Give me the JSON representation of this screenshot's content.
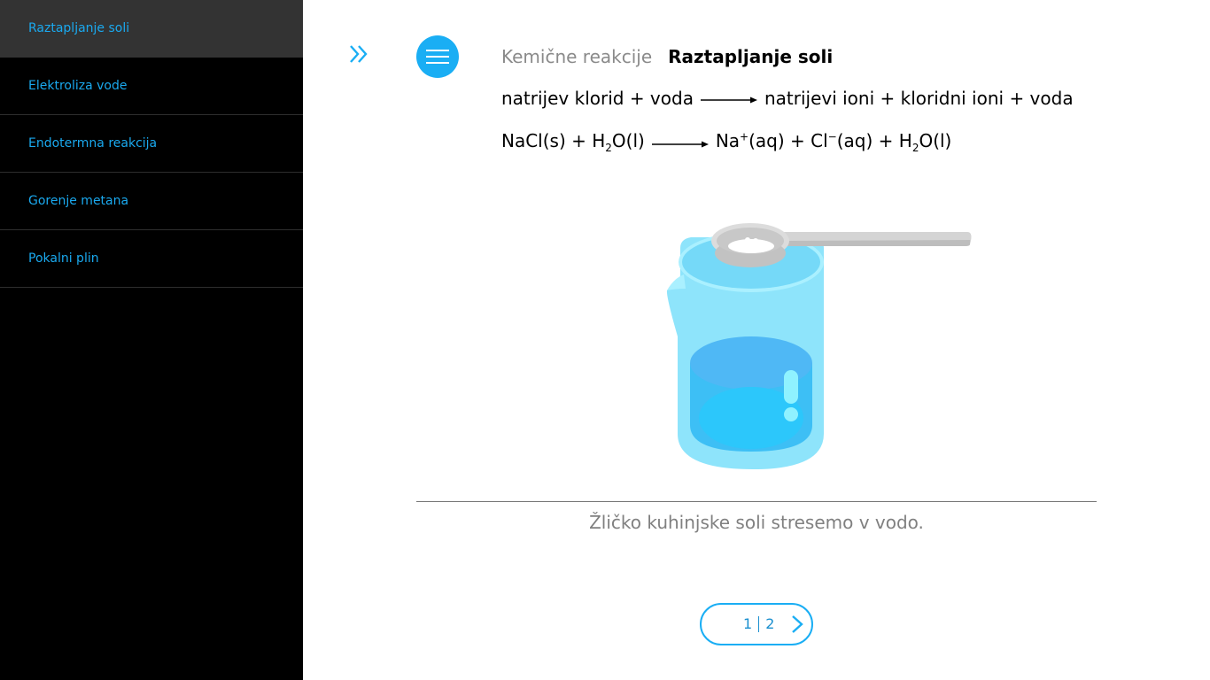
{
  "sidebar": {
    "items": [
      {
        "label": "Raztapljanje soli",
        "active": true
      },
      {
        "label": "Elektroliza vode",
        "active": false
      },
      {
        "label": "Endotermna reakcija",
        "active": false
      },
      {
        "label": "Gorenje metana",
        "active": false
      },
      {
        "label": "Pokalni plin",
        "active": false
      }
    ]
  },
  "header": {
    "parent": "Kemične reakcije",
    "current": "Raztapljanje soli"
  },
  "equation_words": {
    "left": "natrijev klorid + voda",
    "right": "natrijevi ioni + kloridni ioni + voda"
  },
  "equation_formula": {
    "nacl": "NaCl(s) + H",
    "h2o_sub": "2",
    "h2o_rest": "O(l)",
    "na": "Na",
    "na_sup": "+",
    "na_rest": "(aq) + Cl",
    "cl_sup": "−",
    "cl_rest": "(aq) + H",
    "h2o2_sub": "2",
    "h2o2_rest": "O(l)"
  },
  "caption": "Žličko kuhinjske soli stresemo v vodo.",
  "pager": {
    "current": "1",
    "total": "2"
  },
  "colors": {
    "accent": "#1aaef4",
    "sidebar_bg": "#000000",
    "sidebar_active": "#333333"
  },
  "icons": {
    "expand": "double-chevron-right-icon",
    "menu": "hamburger-icon",
    "next": "chevron-right-icon"
  }
}
